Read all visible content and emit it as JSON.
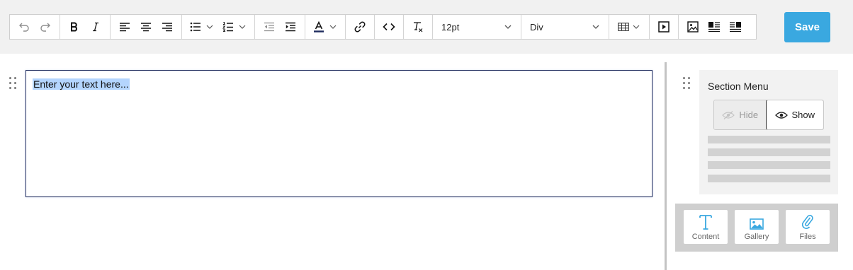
{
  "toolbar": {
    "font_size": "12pt",
    "block_format": "Div",
    "save_label": "Save"
  },
  "editor": {
    "content": "Enter your text here..."
  },
  "section_menu": {
    "title": "Section Menu",
    "hide_label": "Hide",
    "show_label": "Show"
  },
  "add_buttons": {
    "content_label": "Content",
    "gallery_label": "Gallery",
    "files_label": "Files"
  },
  "colors": {
    "accent": "#3aa8e0",
    "editor_border": "#1f2c5e",
    "selection": "#b4d5fe"
  }
}
